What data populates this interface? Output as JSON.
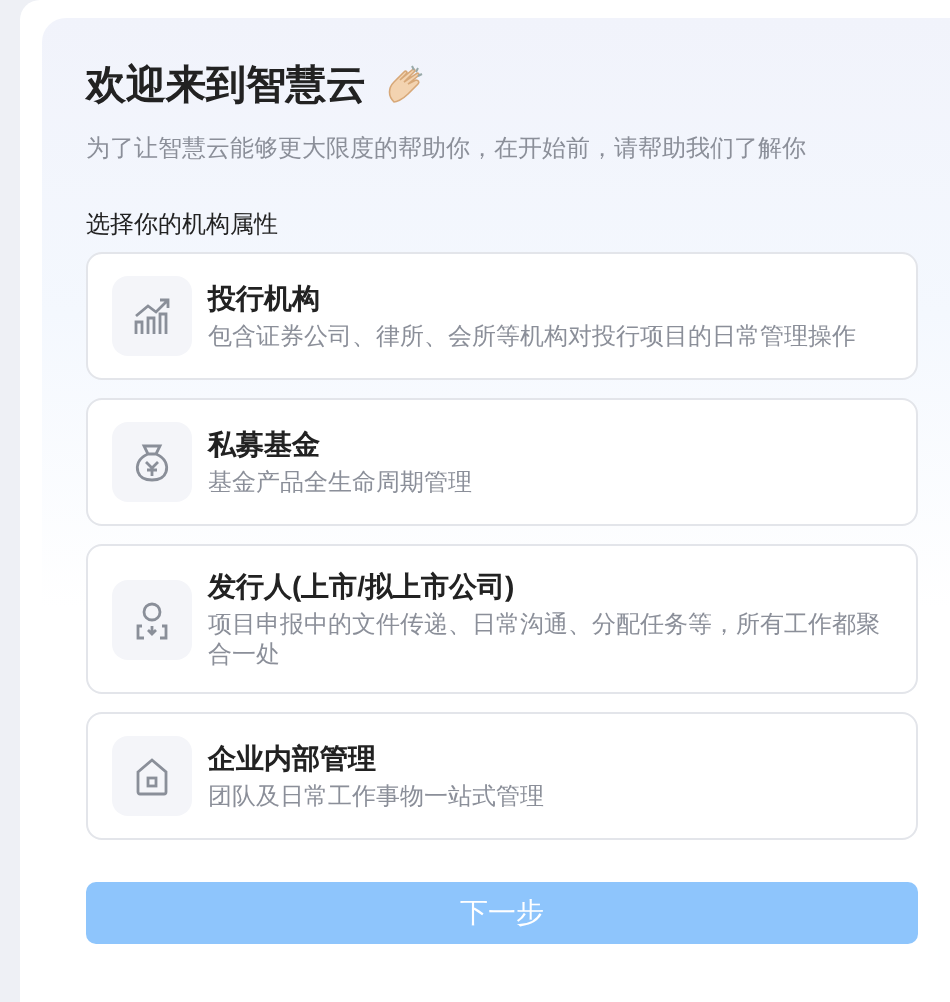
{
  "header": {
    "title": "欢迎来到智慧云",
    "subtitle": "为了让智慧云能够更大限度的帮助你，在开始前，请帮助我们了解你"
  },
  "section_label": "选择你的机构属性",
  "options": [
    {
      "kind": "chart",
      "title": "投行机构",
      "description": "包含证券公司、律所、会所等机构对投行项目的日常管理操作",
      "selected": false
    },
    {
      "kind": "money-bag",
      "title": "私募基金",
      "description": "基金产品全生命周期管理",
      "selected": false
    },
    {
      "kind": "person",
      "title": "发行人(上市/拟上市公司)",
      "description": "项目申报中的文件传递、日常沟通、分配任务等，所有工作都聚合一处",
      "selected": false
    },
    {
      "kind": "house",
      "title": "企业内部管理",
      "description": "团队及日常工作事物一站式管理",
      "selected": false
    }
  ],
  "next_button": {
    "label": "下一步",
    "disabled": true
  }
}
